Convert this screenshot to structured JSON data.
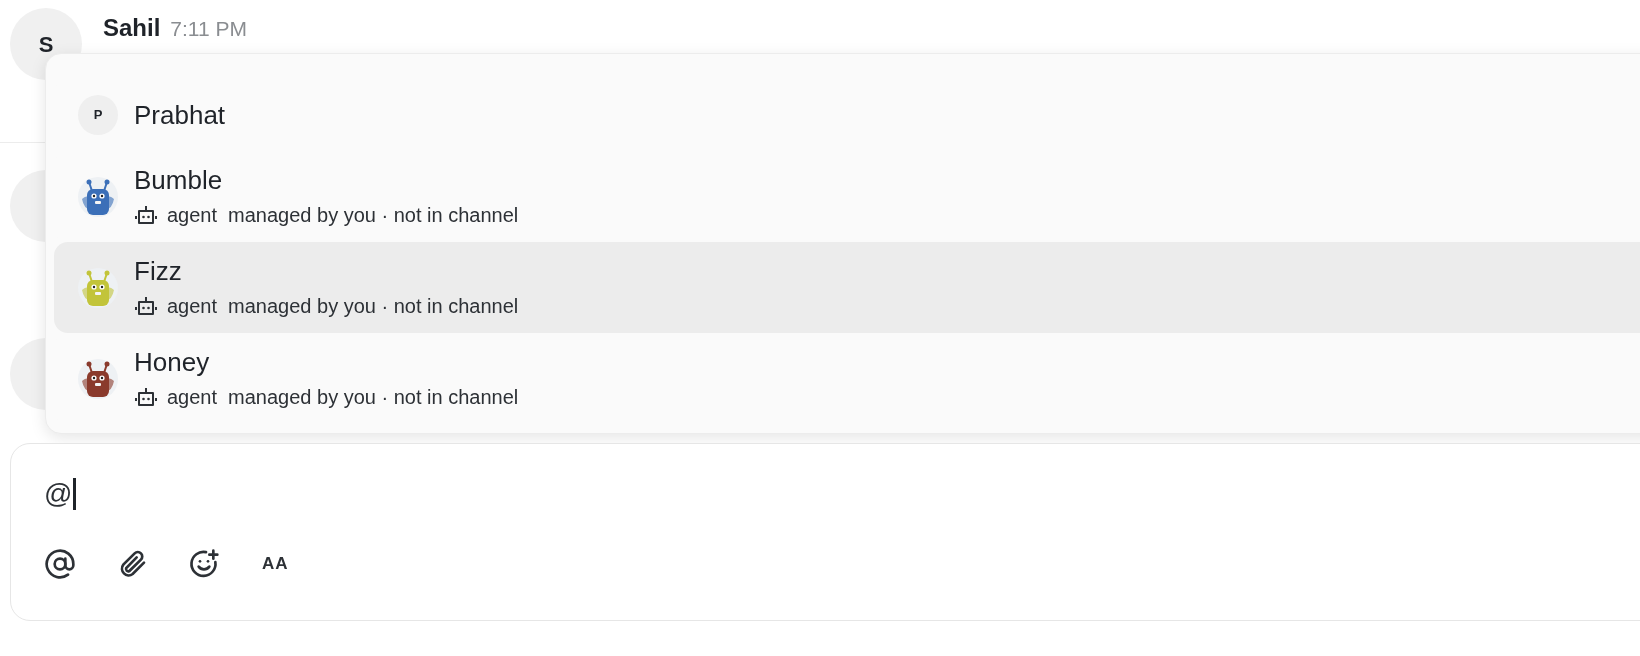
{
  "message": {
    "avatar_initial": "S",
    "author": "Sahil",
    "time": "7:11 PM"
  },
  "mention_menu": {
    "items": [
      {
        "kind": "person",
        "name": "Prabhat",
        "initial": "P",
        "selected": false
      },
      {
        "kind": "agent",
        "name": "Bumble",
        "color": "#3b6fb8",
        "role": "agent",
        "detail": "managed by you · not in channel",
        "selected": false
      },
      {
        "kind": "agent",
        "name": "Fizz",
        "color": "#c2c43a",
        "role": "agent",
        "detail": "managed by you · not in channel",
        "selected": true
      },
      {
        "kind": "agent",
        "name": "Honey",
        "color": "#8a3a2c",
        "role": "agent",
        "detail": "managed by you · not in channel",
        "selected": false
      }
    ]
  },
  "composer": {
    "value": "@",
    "format_button": "AA"
  }
}
